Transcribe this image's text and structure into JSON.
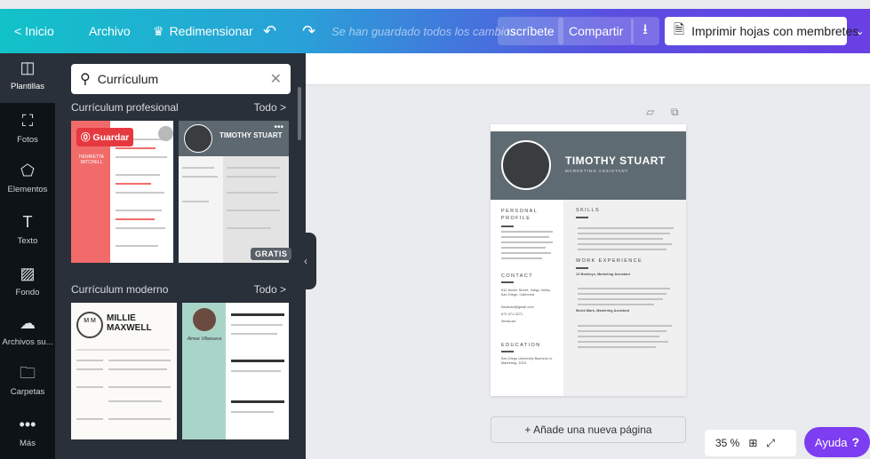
{
  "topbar": {
    "home_label": "< Inicio",
    "file_label": "Archivo",
    "resize_icon": "crown",
    "resize_label": "Redimensionar",
    "undo_icon": "undo-arrow",
    "redo_icon": "redo-arrow",
    "save_status": "Se han guardado todos los cambios",
    "subscribe_label": "ıscríbete",
    "share_label": "Compartir",
    "download_icon": "download-arrow",
    "print_label": "Imprimir hojas con membretes",
    "print_icon": "document-icon",
    "more_icon": "chevron-down"
  },
  "rail": {
    "items": [
      {
        "icon": "layout-icon",
        "label": "Plantillas",
        "active": true
      },
      {
        "icon": "image-icon",
        "label": "Fotos"
      },
      {
        "icon": "shapes-icon",
        "label": "Elementos"
      },
      {
        "icon": "text-icon",
        "label": "Texto"
      },
      {
        "icon": "hatch-icon",
        "label": "Fondo"
      },
      {
        "icon": "upload-cloud-icon",
        "label": "Archivos su..."
      },
      {
        "icon": "folder-icon",
        "label": "Carpetas"
      },
      {
        "icon": "more-dots-icon",
        "label": "Más"
      }
    ]
  },
  "panel": {
    "search_value": "Currículum",
    "section1_title": "Currículum profesional",
    "section1_all": "Todo >",
    "section2_title": "Currículum moderno",
    "section2_all": "Todo >",
    "save_badge": "Guardar",
    "free_badge": "GRATIS",
    "thumb1_name": "HENRIETTA MITCHELL",
    "thumb2_name": "TIMOTHY STUART",
    "thumb3_initials": "M M",
    "thumb3_name": "MILLIE MAXWELL",
    "thumb4_name": "Aimee Villanueva"
  },
  "page": {
    "name": "TIMOTHY STUART",
    "role": "MARKETING ASSISTANT",
    "sections": {
      "profile": "PERSONAL PROFILE",
      "contact": "CONTACT",
      "education": "EDUCATION",
      "skills": "SKILLS",
      "experience": "WORK EXPERIENCE"
    },
    "contact_items": [
      "512 Moore Street, Indigo Valley, San Diego, California",
      "timstuart@gmail.com",
      "672-371-3271",
      "/timstuart"
    ],
    "education_text": "San Diego University Bachelor in Marketing, 2016",
    "experience_company": "13 Monkeys, Marketing Assistant",
    "experience_company2": "World Mark, Marketing Assistant"
  },
  "footer": {
    "add_page": "+ Añade una nueva página",
    "zoom": "35 %",
    "grid_icon": "grid-icon",
    "expand_icon": "expand-icon",
    "help_label": "Ayuda",
    "help_mark": "?"
  },
  "colors": {
    "accent": "#7d3df0",
    "rail_bg": "#0e1318",
    "panel_bg": "#293039",
    "header_gradient_start": "#12c2c9",
    "header_gradient_end": "#6a3fe4"
  }
}
